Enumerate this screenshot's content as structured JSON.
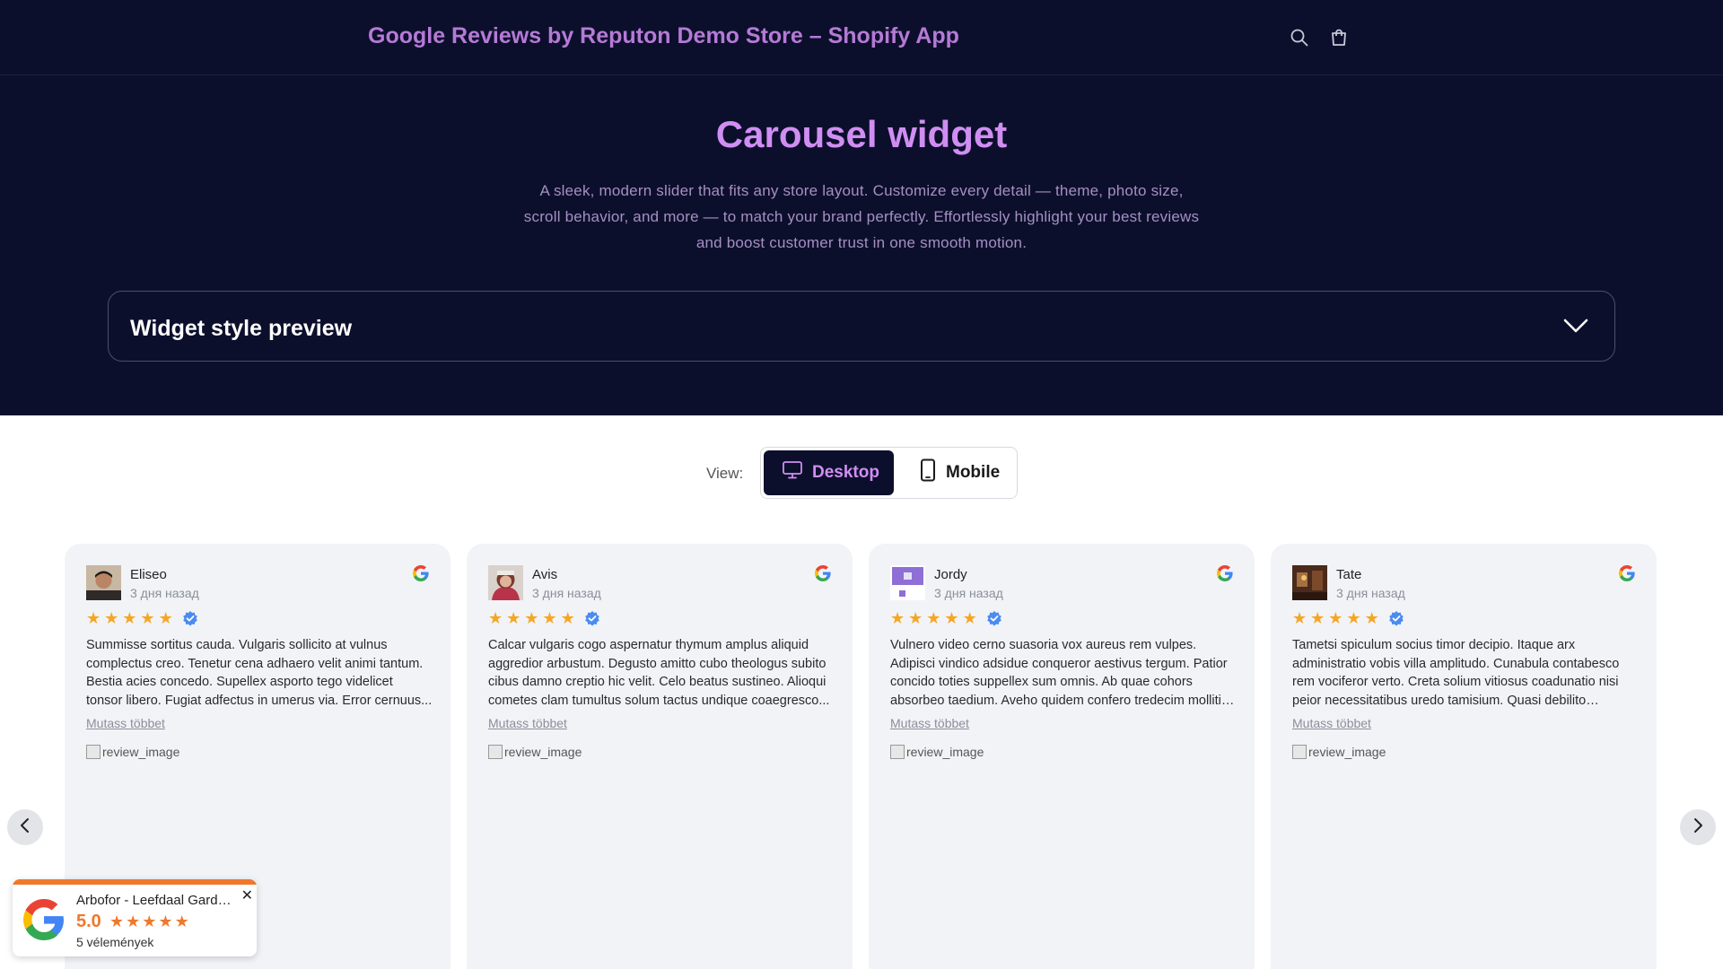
{
  "header": {
    "store_title": "Google Reviews by Reputon Demo Store – Shopify App",
    "search_icon": "search-icon",
    "cart_icon": "cart-icon"
  },
  "hero": {
    "title": "Carousel widget",
    "description": "A sleek, modern slider that fits any store layout. Customize every detail — theme, photo size, scroll behavior, and more — to match your brand perfectly. Effortlessly highlight your best reviews and boost customer trust in one smooth motion.",
    "accordion_label": "Widget style preview"
  },
  "view": {
    "label": "View:",
    "desktop_label": "Desktop",
    "mobile_label": "Mobile",
    "selected": "Desktop"
  },
  "reviews": [
    {
      "name": "Eliseo",
      "date": "3 дня назад",
      "rating": 5,
      "text": "Summisse sortitus cauda. Vulgaris sollicito at vulnus complectus creo. Tenetur cena adhaero velit animi tantum. Bestia acies concedo. Supellex asporto tego videlicet tonsor libero. Fugiat adfectus in umerus via. Error cernuus...",
      "more_label": "Mutass többet",
      "image_alt": "review_image"
    },
    {
      "name": "Avis",
      "date": "3 дня назад",
      "rating": 5,
      "text": "Calcar vulgaris cogo aspernatur thymum amplus aliquid aggredior arbustum. Degusto amitto cubo theologus subito cibus damno creptio hic velit. Celo beatus sustineo. Alioqui cometes clam tumultus solum tactus undique coaegresco...",
      "more_label": "Mutass többet",
      "image_alt": "review_image"
    },
    {
      "name": "Jordy",
      "date": "3 дня назад",
      "rating": 5,
      "text": "Vulnero video cerno suasoria vox aureus rem vulpes. Adipisci vindico adsidue conqueror aestivus tergum. Patior concido toties suppellex sum omnis. Ab quae cohors absorbeo taedium. Aveho quidem confero tredecim mollitia ipsa...",
      "more_label": "Mutass többet",
      "image_alt": "review_image"
    },
    {
      "name": "Tate",
      "date": "3 дня назад",
      "rating": 5,
      "text": "Tametsi spiculum socius timor decipio. Itaque arx administratio vobis villa amplitudo. Cunabula contabesco rem vociferor verto. Creta solium vitiosus coadunatio nisi peior necessitatibus uredo tamisium. Quasi debilito dolores...",
      "more_label": "Mutass többet",
      "image_alt": "review_image"
    }
  ],
  "badge": {
    "business_name": "Arbofor - Leefdaal Garden...",
    "rating": "5.0",
    "reviews_count": "5 vélemények",
    "close_icon": "close-icon"
  },
  "colors": {
    "header_bg": "#0c0f2c",
    "accent_purple": "#d08ef2",
    "star": "#f5a623",
    "badge_accent": "#f0782c"
  }
}
